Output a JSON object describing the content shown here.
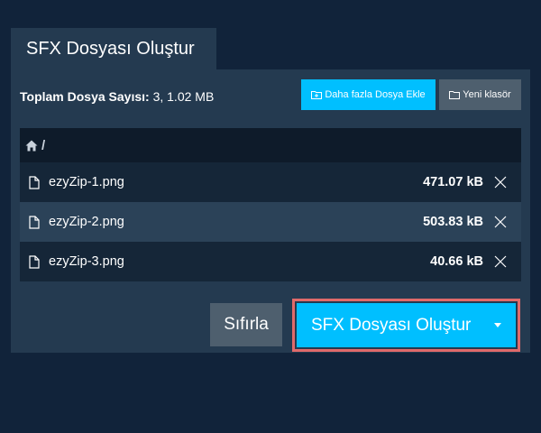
{
  "tab": {
    "title": "SFX Dosyası Oluştur"
  },
  "summary": {
    "label": "Toplam Dosya Sayısı:",
    "value": "3, 1.02 MB"
  },
  "toolbar": {
    "add_more_label": "Daha fazla Dosya Ekle",
    "new_folder_label": "Yeni klasör"
  },
  "path": {
    "current": "/"
  },
  "files": [
    {
      "name": "ezyZip-1.png",
      "size": "471.07 kB"
    },
    {
      "name": "ezyZip-2.png",
      "size": "503.83 kB"
    },
    {
      "name": "ezyZip-3.png",
      "size": "40.66 kB"
    }
  ],
  "actions": {
    "reset_label": "Sıfırla",
    "create_label": "SFX Dosyası Oluştur"
  },
  "colors": {
    "background": "#11233a",
    "panel": "#243a50",
    "accent": "#00bfff",
    "secondary_button": "#4e5f6e",
    "highlight_border": "#e06a6a"
  }
}
